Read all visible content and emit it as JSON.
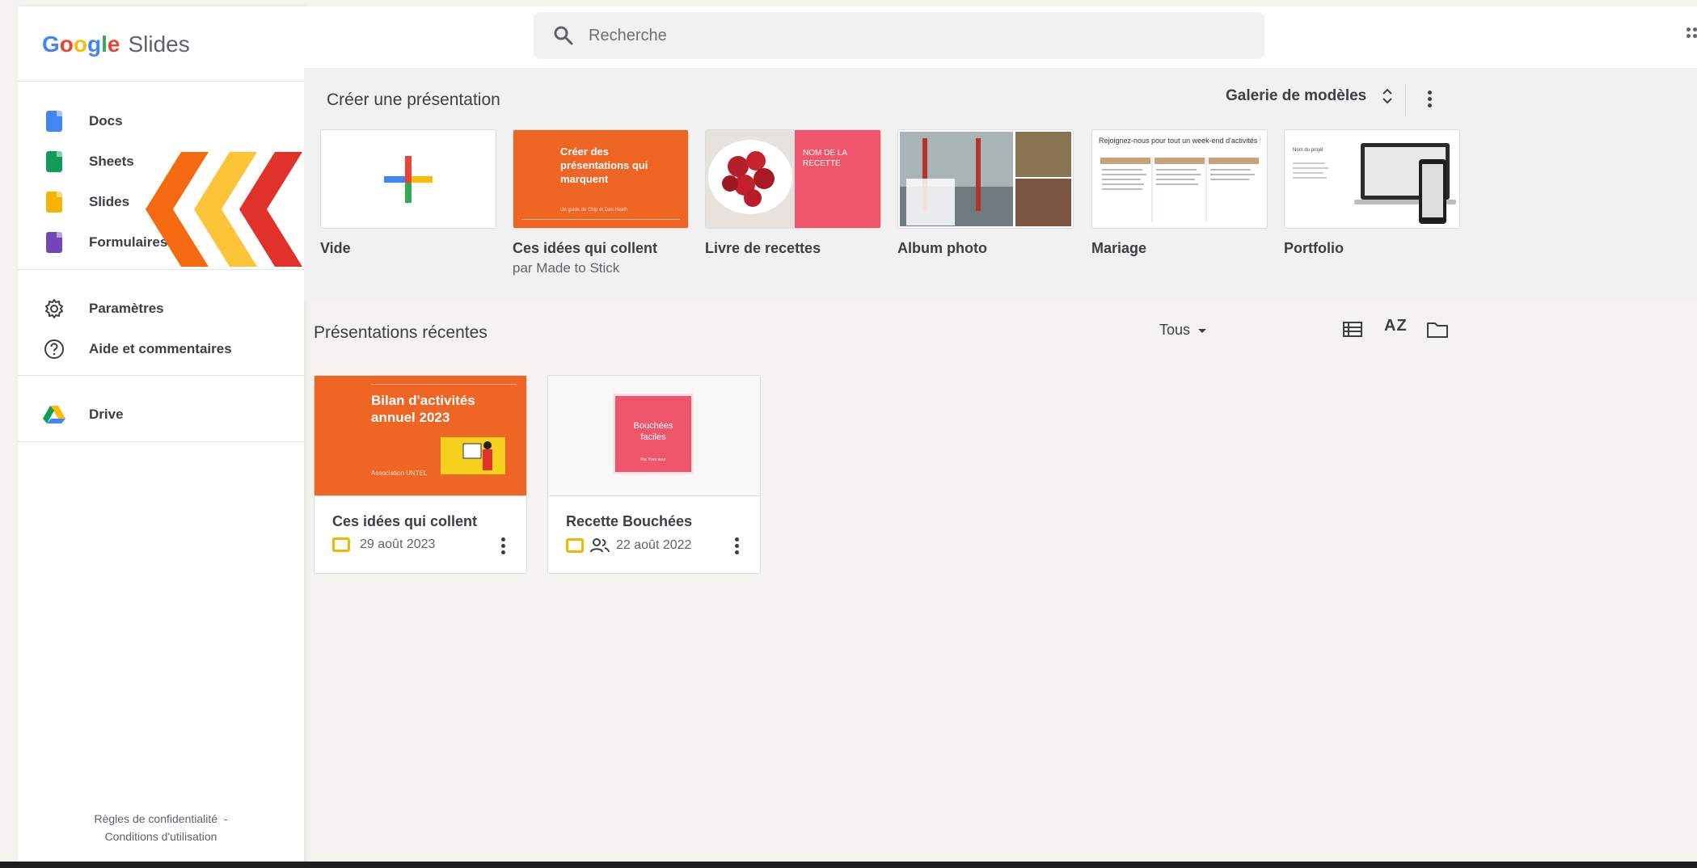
{
  "brand": {
    "g": "G",
    "o1": "o",
    "o2": "o",
    "g2": "g",
    "l": "l",
    "e": "e",
    "product": "Slides"
  },
  "sidebar": {
    "items": [
      {
        "label": "Docs",
        "icon": "docs-icon",
        "color": "#4285f4"
      },
      {
        "label": "Sheets",
        "icon": "sheets-icon",
        "color": "#0f9d58"
      },
      {
        "label": "Slides",
        "icon": "slides-icon",
        "color": "#f4b400"
      },
      {
        "label": "Formulaires",
        "icon": "forms-icon",
        "color": "#7248b9"
      }
    ],
    "settings_label": "Paramètres",
    "help_label": "Aide et commentaires",
    "drive_label": "Drive",
    "privacy_label": "Règles de confidentialité",
    "privacy_sep": "-",
    "terms_label": "Conditions d'utilisation"
  },
  "search": {
    "placeholder": "Recherche"
  },
  "create": {
    "title": "Créer une présentation",
    "gallery_label": "Galerie de modèles",
    "templates": [
      {
        "name": "Vide",
        "sub": ""
      },
      {
        "name": "Ces idées qui collent",
        "sub": "par Made to Stick",
        "thumb_title": "Créer des présentations qui marquent",
        "thumb_foot": "Un guide de Chip et Dan Heath"
      },
      {
        "name": "Livre de recettes",
        "sub": "",
        "thumb_title": "NOM DE LA RECETTE"
      },
      {
        "name": "Album photo",
        "sub": ""
      },
      {
        "name": "Mariage",
        "sub": "",
        "thumb_title": "Rejoignez-nous pour tout un week-end d'activités !"
      },
      {
        "name": "Portfolio",
        "sub": "",
        "thumb_title": "Nom du projet"
      }
    ]
  },
  "recent": {
    "title": "Présentations récentes",
    "filter_label": "Tous",
    "cards": [
      {
        "title": "Ces idées qui collent",
        "date": "29 août 2023",
        "thumb_title": "Bilan d'activités annuel 2023",
        "thumb_foot": "Association UNTEL"
      },
      {
        "title": "Recette Bouchées",
        "date": "22 août 2022",
        "shared": true,
        "thumb_title": "Bouchées faciles",
        "thumb_foot": "Par Yves auur"
      }
    ]
  },
  "colors": {
    "arrow_orange": "#f46a10",
    "arrow_yellow": "#fdc43a",
    "arrow_red": "#e0312b",
    "accent_orange": "#ef6524"
  }
}
